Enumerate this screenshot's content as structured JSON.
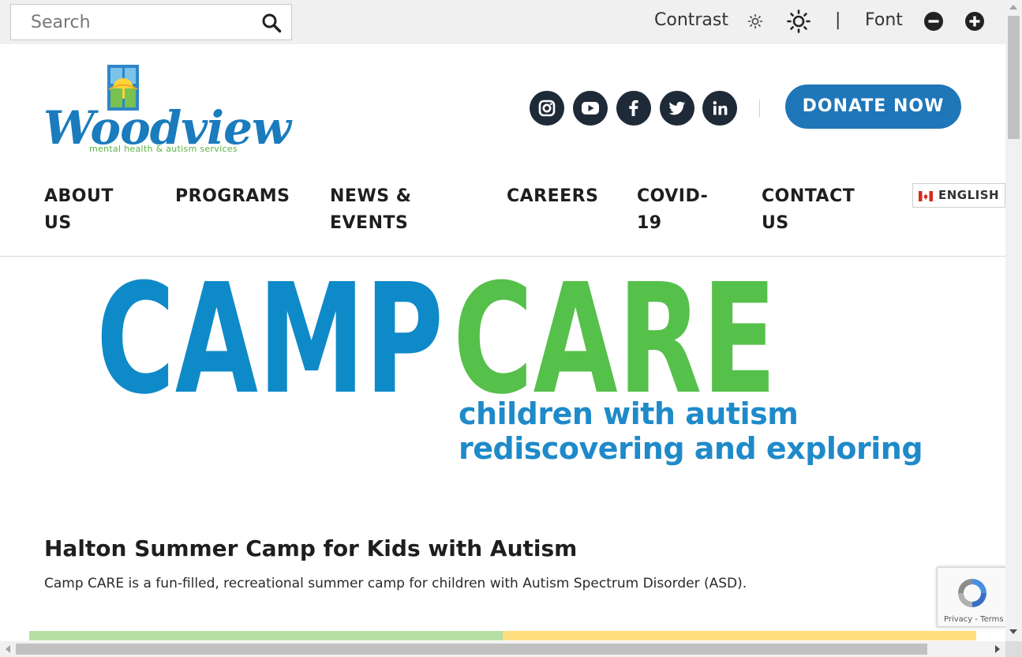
{
  "topbar": {
    "search_placeholder": "Search",
    "contrast_label": "Contrast",
    "divider": "|",
    "font_label": "Font"
  },
  "header": {
    "logo_text": "Woodview",
    "logo_tagline": "mental health & autism services",
    "donate_label": "DONATE NOW",
    "social": [
      "instagram-icon",
      "youtube-icon",
      "facebook-icon",
      "twitter-icon",
      "linkedin-icon"
    ],
    "brand_blue": "#1f76b8",
    "brand_green": "#5db244"
  },
  "nav": {
    "items": [
      {
        "line1": "ABOUT",
        "line2": "US"
      },
      {
        "line1": "PROGRAMS",
        "line2": ""
      },
      {
        "line1": "NEWS &",
        "line2": "EVENTS"
      },
      {
        "line1": "CAREERS",
        "line2": ""
      },
      {
        "line1": "COVID-",
        "line2": "19"
      },
      {
        "line1": "CONTACT",
        "line2": "US"
      }
    ],
    "language": "ENGLISH"
  },
  "hero": {
    "camp": "CAMP",
    "care": "CARE",
    "subtitle_line1": "children with autism",
    "subtitle_line2": "rediscovering and exploring",
    "camp_color": "#0f8ac8",
    "care_color": "#55c04a"
  },
  "content": {
    "heading": "Halton Summer Camp for Kids with Autism",
    "lead": "Camp CARE is a fun-filled, recreational summer camp for children with Autism Spectrum Disorder (ASD)."
  },
  "recaptcha": {
    "links": "Privacy - Terms"
  }
}
